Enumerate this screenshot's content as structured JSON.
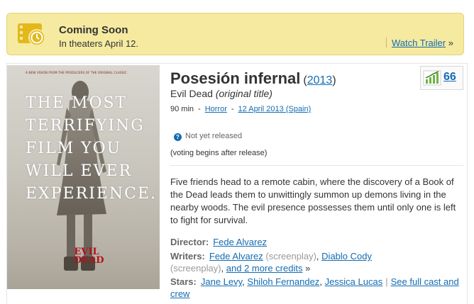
{
  "banner": {
    "title": "Coming Soon",
    "subtitle": "In theaters April 12.",
    "trailer_label": "Watch Trailer",
    "trailer_suffix": "»",
    "icon": "film-clock-icon",
    "accent": "#f5eaa0"
  },
  "poster": {
    "tagline": "A NEW VISION FROM THE PRODUCERS OF THE ORIGINAL CLASSIC",
    "line1": "THE MOST",
    "line2": "TERRIFYING",
    "line3": "FILM YOU",
    "line4": "WILL EVER",
    "line5": "EXPERIENCE.",
    "logo_top": "EVIL",
    "logo_bottom": "DEAD"
  },
  "movie": {
    "title": "Posesión infernal",
    "year_open": "(",
    "year": "2013",
    "year_close": ")",
    "original_title": "Evil Dead",
    "original_note": "(original title)",
    "runtime": "90 min",
    "separator": "-",
    "genre": "Horror",
    "release_date": "12 April 2013 (Spain)",
    "metascore": "66"
  },
  "rating": {
    "status": "Not yet released",
    "note": "(voting begins after release)",
    "info_icon": "?"
  },
  "plot": "Five friends head to a remote cabin, where the discovery of a Book of the Dead leads them to unwittingly summon up demons living in the nearby woods. The evil presence possesses them until only one is left to fight for survival.",
  "credits": {
    "director_label": "Director:",
    "director": "Fede Alvarez",
    "writers_label": "Writers:",
    "writer1": "Fede Alvarez",
    "writer1_role": "(screenplay)",
    "writer2": "Diablo Cody",
    "writer2_role": "(screenplay)",
    "more_credits": "and 2 more credits",
    "more_suffix": "»",
    "stars_label": "Stars:",
    "star1": "Jane Levy",
    "star2": "Shiloh Fernandez",
    "star3": "Jessica Lucas",
    "full_cast": "See full cast and crew",
    "comma": ",",
    "pipe": "|"
  },
  "colors": {
    "link": "#136cb2",
    "metascore_green": "#6fb43f"
  }
}
